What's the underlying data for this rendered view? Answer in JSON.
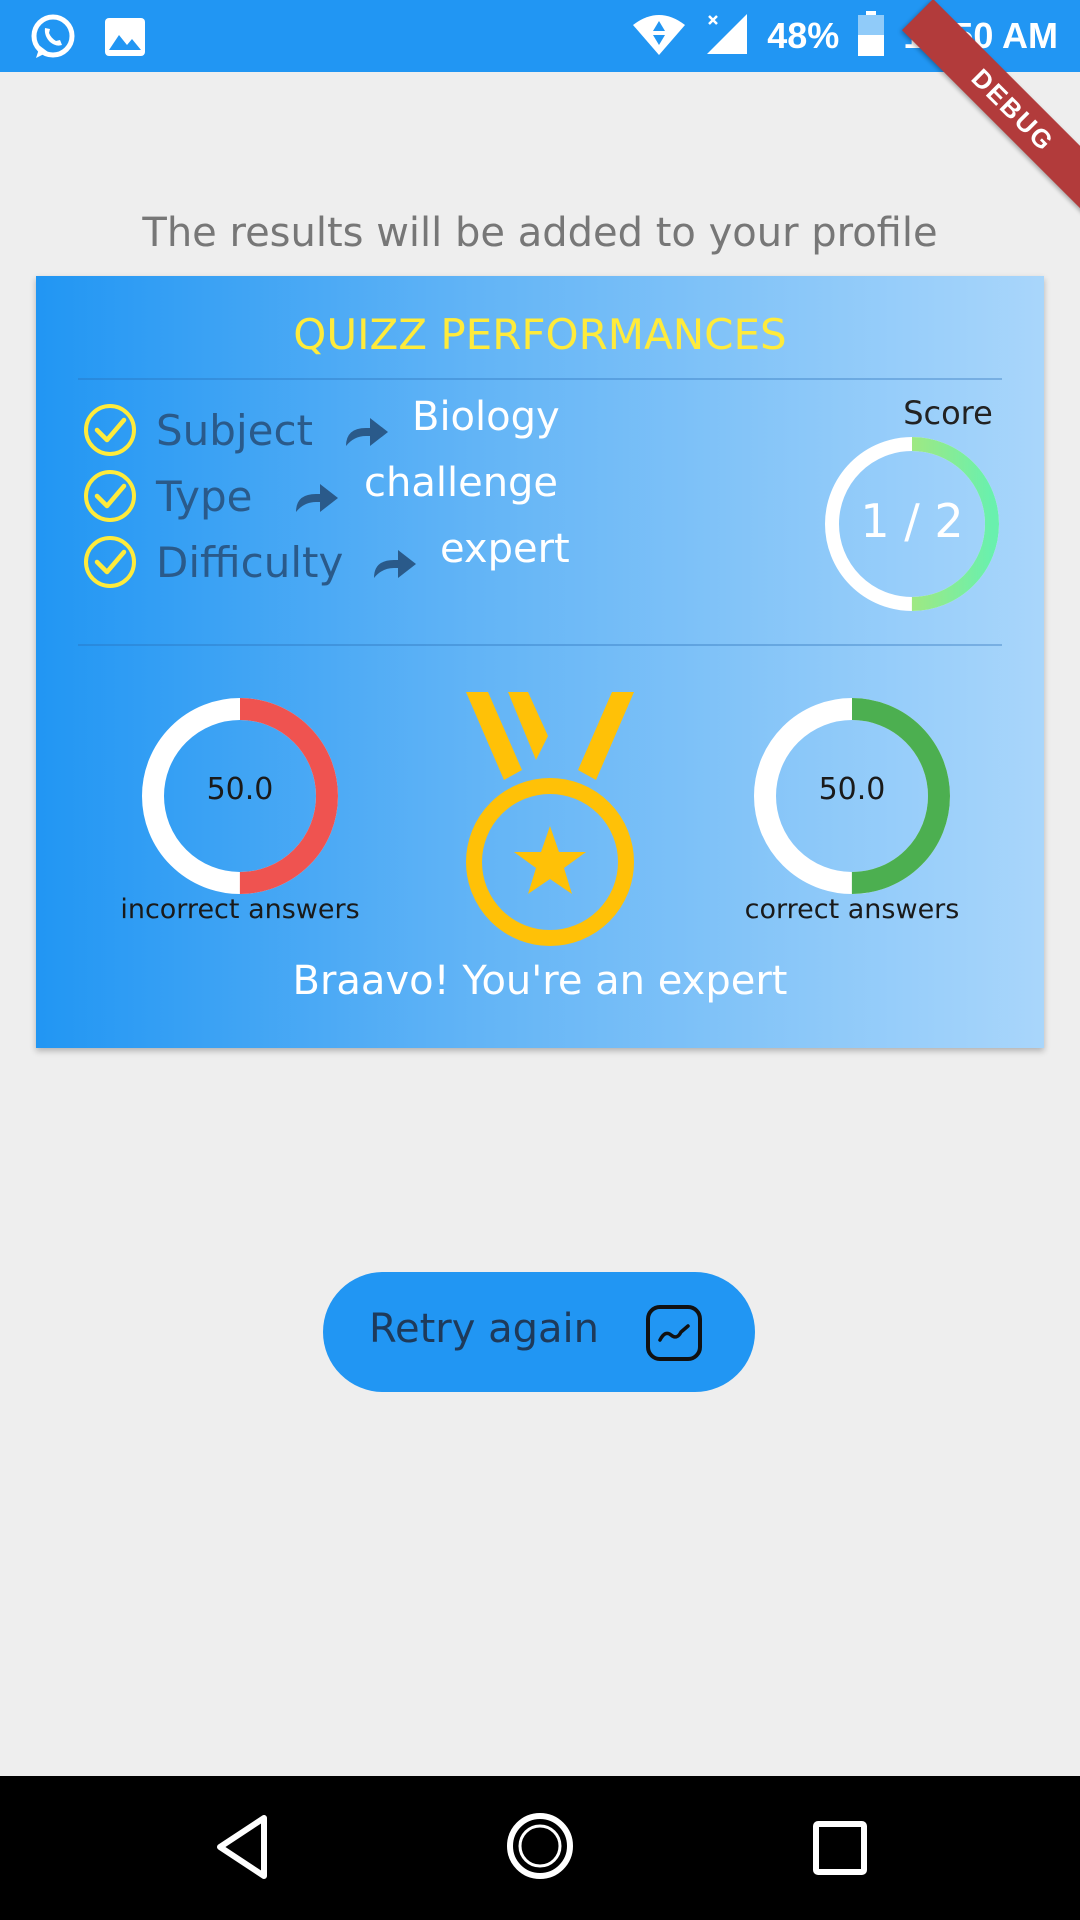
{
  "status_bar": {
    "battery": "48%",
    "time": "11:50 AM",
    "icons": [
      "whatsapp-icon",
      "gallery-icon",
      "wifi-icon",
      "signal-icon",
      "battery-icon"
    ]
  },
  "debug_banner": "DEBUG",
  "subtitle": "The results will be added to your profile",
  "card": {
    "title": "QUIZZ PERFORMANCES",
    "details": [
      {
        "label": "Subject",
        "value": "Biology"
      },
      {
        "label": "Type",
        "value": "challenge"
      },
      {
        "label": "Difficulty",
        "value": "expert"
      }
    ],
    "score": {
      "label": "Score",
      "value": "1 / 2",
      "fraction": 0.5
    },
    "incorrect": {
      "value": "50.0",
      "caption": "incorrect answers",
      "percent": 50
    },
    "correct": {
      "value": "50.0",
      "caption": "correct answers",
      "percent": 50
    },
    "message": "Braavo! You're an expert"
  },
  "retry_button": {
    "label": "Retry again",
    "icon": "chart-trend-icon"
  },
  "nav": [
    "back-icon",
    "home-icon",
    "recents-icon"
  ],
  "colors": {
    "primary": "#2196f3",
    "title_yellow": "#ffeb3b",
    "incorrect_red": "#ef5350",
    "correct_green": "#4caf50",
    "medal_gold": "#ffc107"
  }
}
